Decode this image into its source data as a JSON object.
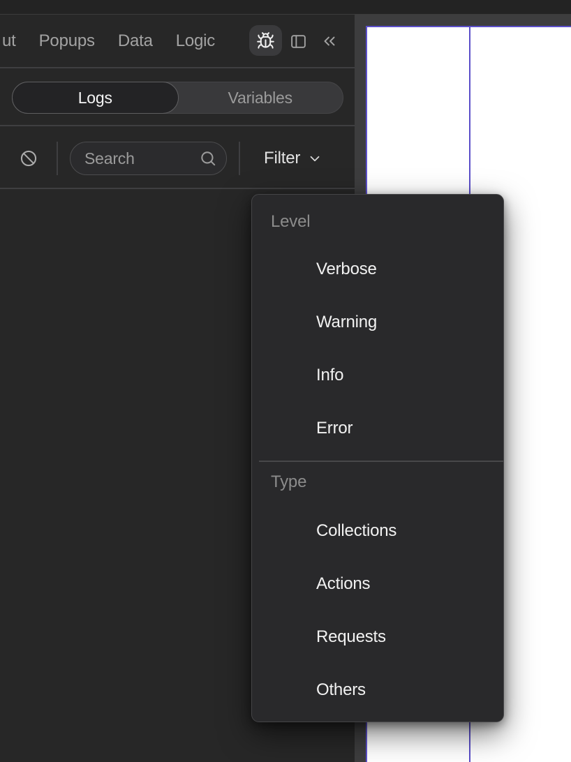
{
  "topbar": {
    "nav_items": [
      {
        "label": "ut"
      },
      {
        "label": "Popups"
      },
      {
        "label": "Data"
      },
      {
        "label": "Logic"
      }
    ],
    "icons": [
      "bug-icon",
      "split-panel-icon",
      "collapse-panel-icon"
    ]
  },
  "tabs": {
    "items": [
      {
        "label": "Logs",
        "active": true
      },
      {
        "label": "Variables",
        "active": false
      }
    ]
  },
  "toolbar": {
    "search_placeholder": "Search",
    "filter_label": "Filter",
    "icons": [
      "clear-logs-icon",
      "search-icon",
      "chevron-down-icon"
    ]
  },
  "filter_menu": {
    "sections": [
      {
        "header": "Level",
        "items": [
          "Verbose",
          "Warning",
          "Info",
          "Error"
        ]
      },
      {
        "header": "Type",
        "items": [
          "Collections",
          "Actions",
          "Requests",
          "Others"
        ]
      }
    ]
  },
  "colors": {
    "panel_bg": "#272727",
    "top_strip_bg": "#232323",
    "canvas_bg": "#3d3d3e",
    "page_bg": "#ffffff",
    "accent_purple": "#5b4fc9",
    "divider": "#3f3f41",
    "text_primary": "#f2f2f2",
    "text_muted": "#9b9b9b"
  }
}
